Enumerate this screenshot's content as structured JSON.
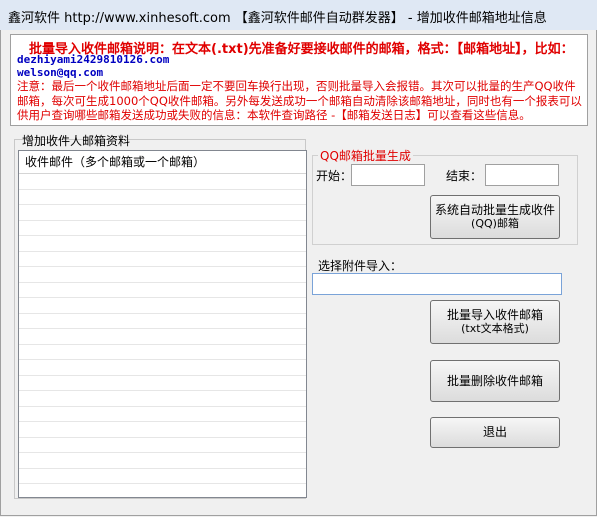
{
  "window": {
    "title": "鑫河软件 http://www.xinhesoft.com 【鑫河软件邮件自动群发器】 - 增加收件邮箱地址信息"
  },
  "info": {
    "heading": "批量导入收件邮箱说明：在文本(.txt)先准备好要接收邮件的邮箱，格式：【邮箱地址】，比如：",
    "examples": [
      "dezhiyami2429810126.com",
      "welson@qq.com"
    ],
    "note": "注意：最后一个收件邮箱地址后面一定不要回车换行出现，否则批量导入会报错。其次可以批量的生产QQ收件邮箱，每次可生成1000个QQ收件邮箱。另外每发送成功一个邮箱自动清除该邮箱地址，同时也有一个报表可以供用户查询哪些邮箱发送成功或失败的信息：本软件查询路径 -【邮箱发送日志】可以查看这些信息。"
  },
  "recipients": {
    "group_label": "增加收件人邮箱资料",
    "column_header": "收件邮件（多个邮箱或一个邮箱）",
    "rows": []
  },
  "qq": {
    "group_label": "QQ邮箱批量生成",
    "start_label": "开始：",
    "start_value": "",
    "end_label": "结束：",
    "end_value": "",
    "generate_button": [
      "系统自动批量生成收件",
      "(QQ)邮箱"
    ]
  },
  "attachment": {
    "label": "选择附件导入：",
    "value": ""
  },
  "buttons": {
    "import": [
      "批量导入收件邮箱",
      "(txt文本格式)"
    ],
    "delete": "批量删除收件邮箱",
    "exit": "退出"
  }
}
